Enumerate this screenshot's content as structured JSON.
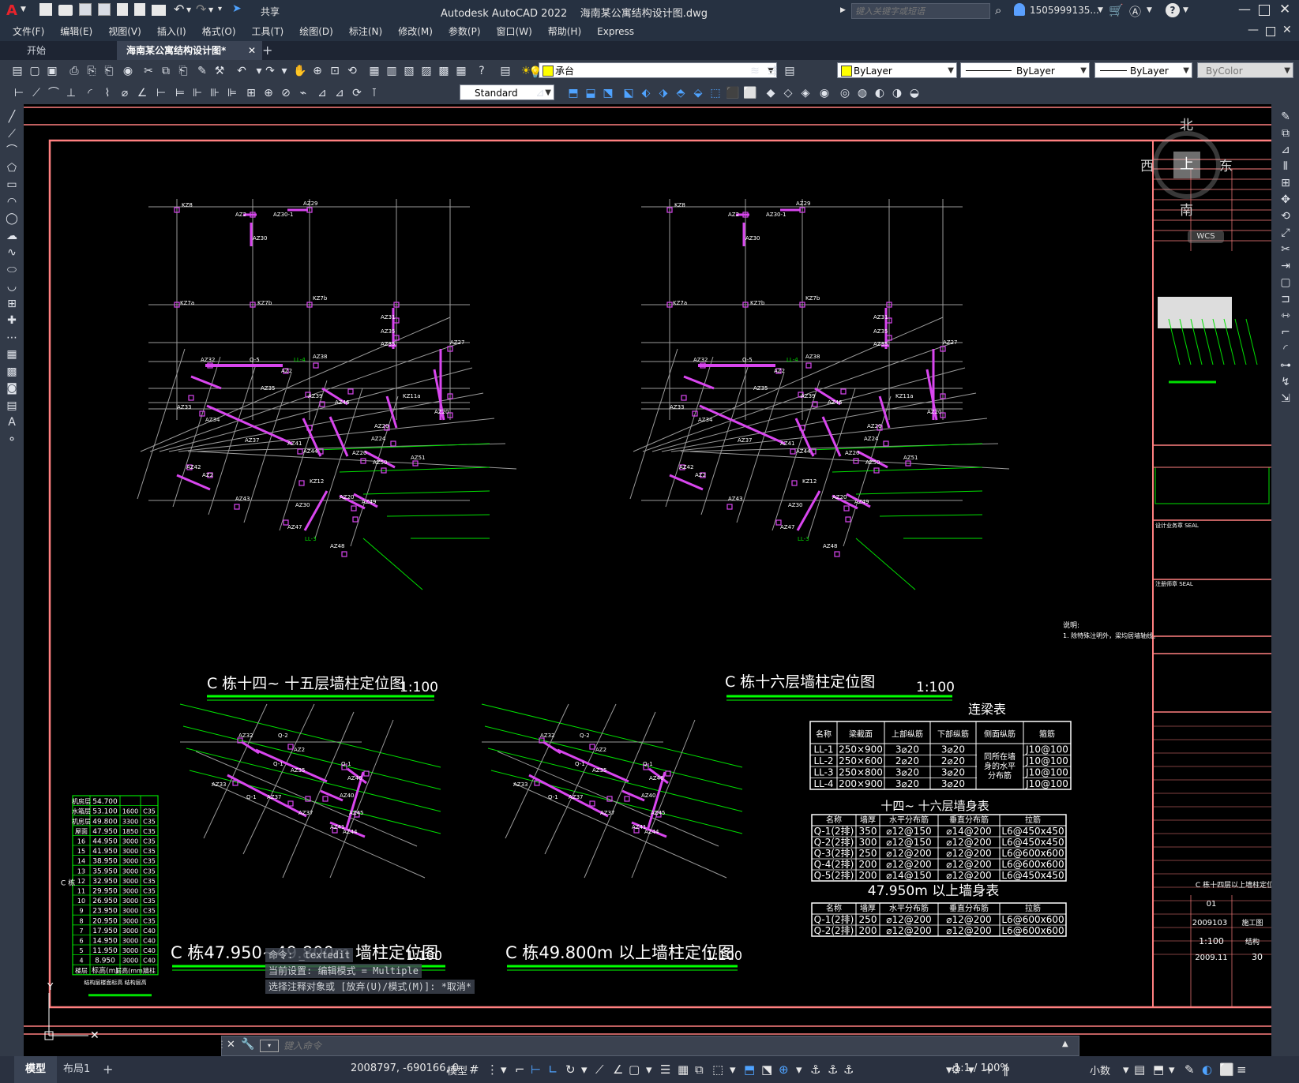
{
  "app": {
    "title": "Autodesk AutoCAD 2022    海南某公寓结构设计图.dwg",
    "share_label": "共享",
    "search_placeholder": "键入关键字或短语",
    "user": "1505999135...",
    "logo": "A"
  },
  "menu": [
    "文件(F)",
    "编辑(E)",
    "视图(V)",
    "插入(I)",
    "格式(O)",
    "工具(T)",
    "绘图(D)",
    "标注(N)",
    "修改(M)",
    "参数(P)",
    "窗口(W)",
    "帮助(H)",
    "Express"
  ],
  "doc_tabs": [
    {
      "label": "开始",
      "active": false
    },
    {
      "label": "海南某公寓结构设计图*",
      "active": true
    }
  ],
  "toolbar": {
    "layer": "承台",
    "color": "ByLayer",
    "linetype": "ByLayer",
    "lineweight": "ByLayer",
    "plotstyle": "ByColor",
    "textstyle": "Standard"
  },
  "viewcube": {
    "north": "北",
    "south": "南",
    "east": "东",
    "west": "西",
    "top": "上",
    "wcs": "WCS"
  },
  "drawing": {
    "title_1": "C 栋十四~ 十五层墙柱定位图",
    "scale_1": "1:100",
    "title_2": "C 栋十六层墙柱定位图",
    "scale_2": "1:100",
    "title_3": "C 栋47.950~49.800m 墙柱定位图",
    "scale_3": "1:100",
    "title_4": "C 栋49.800m 以上墙柱定位图",
    "scale_4": "1:100",
    "note_title": "说明:",
    "note_body": "1. 除特殊注明外，梁均居墙轴线。",
    "beam_table_title": "连梁表",
    "beam_table_headers": [
      "名称",
      "梁截面",
      "上部纵筋",
      "下部纵筋",
      "侧面纵筋",
      "箍筋"
    ],
    "beam_table_rows": [
      [
        "LL-1",
        "250×900",
        "3⌀20",
        "3⌀20",
        "J10@100"
      ],
      [
        "LL-2",
        "250×600",
        "2⌀20",
        "2⌀20",
        "J10@100"
      ],
      [
        "LL-3",
        "250×800",
        "3⌀20",
        "3⌀20",
        "J10@100"
      ],
      [
        "LL-4",
        "200×900",
        "3⌀20",
        "3⌀20",
        "J10@100"
      ]
    ],
    "beam_side_note": "同所在墙身的水平分布筋",
    "wall_table_1_title": "十四~ 十六层墙身表",
    "wall_table_headers": [
      "名称",
      "墙厚",
      "水平分布筋",
      "垂直分布筋",
      "拉筋"
    ],
    "wall_table_1_rows": [
      [
        "Q-1(2排)",
        "350",
        "⌀12@150",
        "⌀14@200",
        "L6@450x450"
      ],
      [
        "Q-2(2排)",
        "300",
        "⌀12@150",
        "⌀12@200",
        "L6@450x450"
      ],
      [
        "Q-3(2排)",
        "250",
        "⌀12@200",
        "⌀12@200",
        "L6@600x600"
      ],
      [
        "Q-4(2排)",
        "200",
        "⌀12@200",
        "⌀12@200",
        "L6@600x600"
      ],
      [
        "Q-5(2排)",
        "200",
        "⌀14@150",
        "⌀12@200",
        "L6@450x450"
      ]
    ],
    "wall_table_2_title": "47.950m 以上墙身表",
    "wall_table_2_rows": [
      [
        "Q-1(2排)",
        "250",
        "⌀12@200",
        "⌀12@200",
        "L6@600x600"
      ],
      [
        "Q-2(2排)",
        "200",
        "⌀12@200",
        "⌀12@200",
        "L6@600x600"
      ]
    ],
    "floor_table": [
      [
        "机房层",
        "54.700",
        "",
        ""
      ],
      [
        "水箱层",
        "53.100",
        "1600",
        "C35"
      ],
      [
        "机房层",
        "49.800",
        "3300",
        "C35"
      ],
      [
        "屋面",
        "47.950",
        "1850",
        "C35"
      ],
      [
        "16",
        "44.950",
        "3000",
        "C35"
      ],
      [
        "15",
        "41.950",
        "3000",
        "C35"
      ],
      [
        "14",
        "38.950",
        "3000",
        "C35"
      ],
      [
        "13",
        "35.950",
        "3000",
        "C35"
      ],
      [
        "12",
        "32.950",
        "3000",
        "C35"
      ],
      [
        "11",
        "29.950",
        "3000",
        "C35"
      ],
      [
        "10",
        "26.950",
        "3000",
        "C35"
      ],
      [
        "9",
        "23.950",
        "3000",
        "C35"
      ],
      [
        "8",
        "20.950",
        "3000",
        "C35"
      ],
      [
        "7",
        "17.950",
        "3000",
        "C40"
      ],
      [
        "6",
        "14.950",
        "3000",
        "C40"
      ],
      [
        "5",
        "11.950",
        "3000",
        "C40"
      ],
      [
        "4",
        "8.950",
        "3000",
        "C40"
      ],
      [
        "楼层",
        "标高(m)",
        "层高(mm)",
        "墙柱"
      ]
    ],
    "floor_table_side": "C 栋",
    "floor_table_caption": "结构层楼面标高 结构层高",
    "title_block": {
      "drawing_name": "C 栋十四层以上墙柱定位图",
      "sheet_no": "01",
      "project_no": "2009103",
      "stage": "施工图",
      "scale": "1:100",
      "discipline": "结构",
      "date": "2009.11",
      "page": "30",
      "seal_1": "设计业务章 SEAL",
      "seal_2": "注册师章 SEAL"
    }
  },
  "command": {
    "history": [
      "命令: _textedit",
      "当前设置: 编辑模式 = Multiple",
      "选择注释对象或 [放弃(U)/模式(M)]: *取消*"
    ],
    "placeholder": "键入命令"
  },
  "layout_tabs": [
    {
      "label": "模型",
      "active": true
    },
    {
      "label": "布局1",
      "active": false
    }
  ],
  "status": {
    "coords": "2008797, -690166, 0",
    "model": "模型",
    "scale": "1:1 / 100%",
    "units": "小数"
  }
}
